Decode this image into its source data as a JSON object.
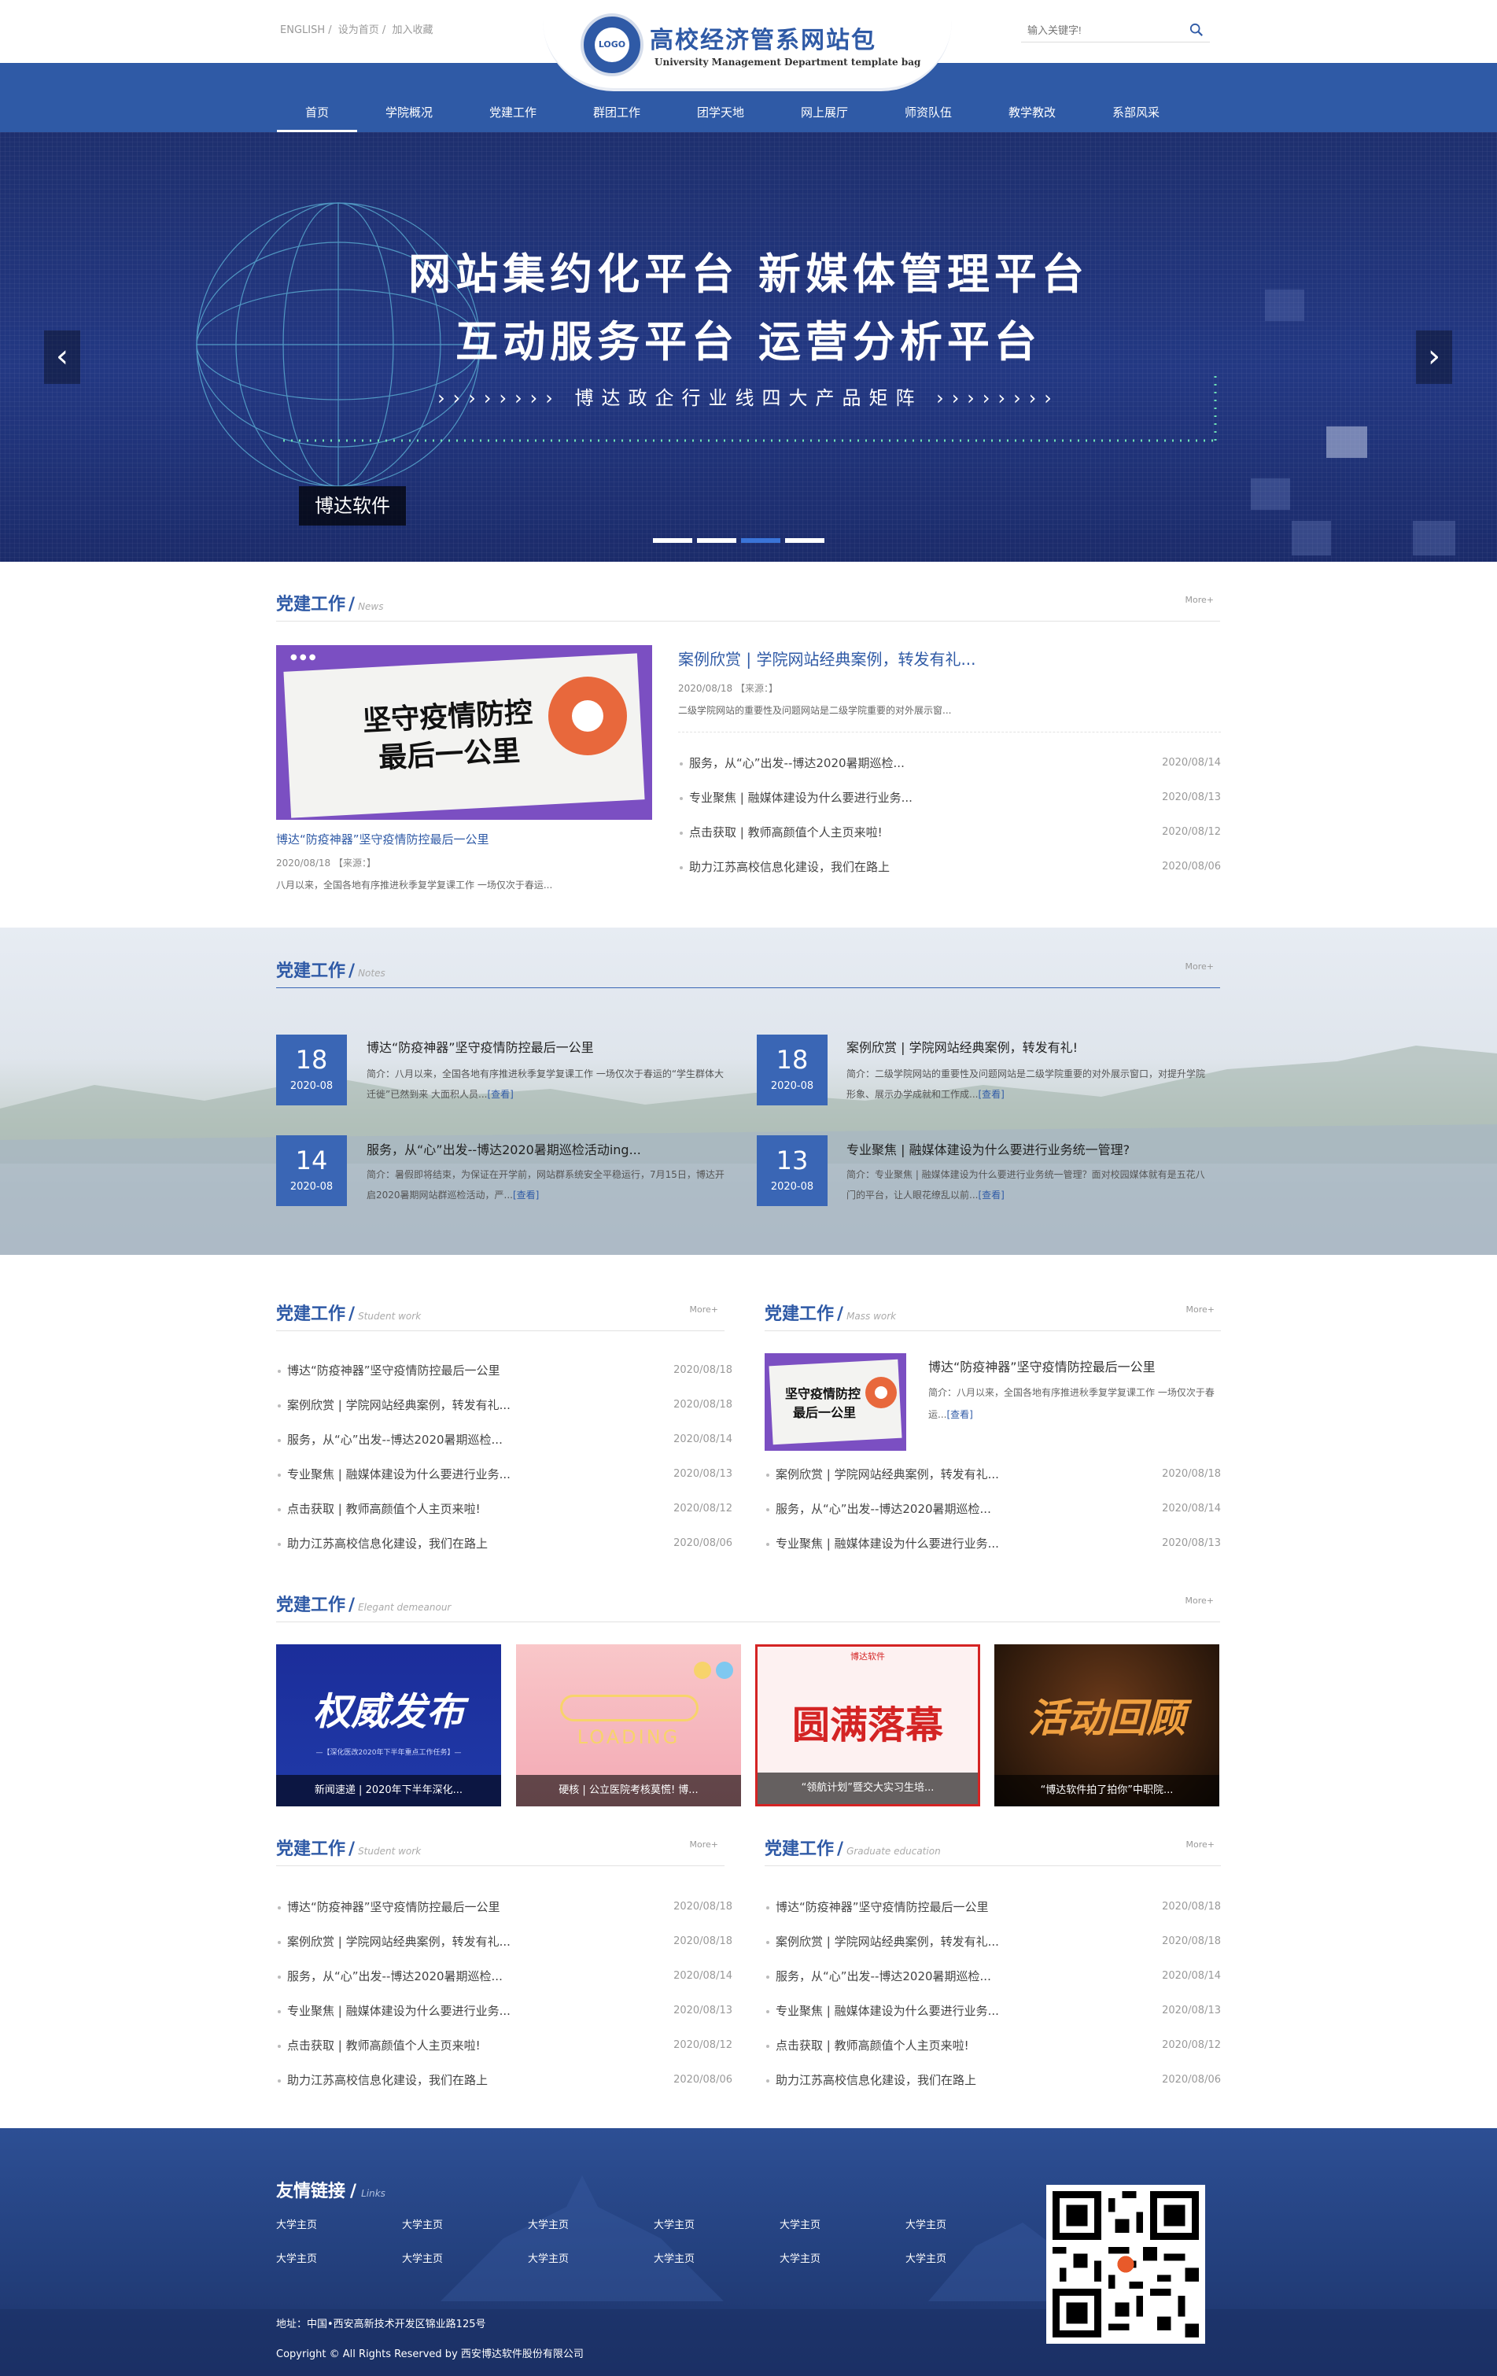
{
  "header": {
    "toplinks": [
      "ENGLISH /",
      "设为首页 /",
      "加入收藏"
    ],
    "logo_text": "LOGO",
    "site_title": "高校经济管系网站包",
    "site_subtitle": "University Management Department template bag",
    "search_placeholder": "输入关键字!",
    "nav": [
      "首页",
      "学院概况",
      "党建工作",
      "群团工作",
      "团学天地",
      "网上展厅",
      "师资队伍",
      "教学教改",
      "系部风采"
    ]
  },
  "banner": {
    "line1": "网站集约化平台  新媒体管理平台",
    "line2": "互动服务平台  运营分析平台",
    "line3": "››››››››  博达政企行业线四大产品矩阵  ››››››››",
    "caption": "博达软件",
    "prev": "‹",
    "next": "›"
  },
  "sec1": {
    "title": "党建工作",
    "en": "News",
    "more": "More+",
    "poster_line1": "坚守疫情防控",
    "poster_line2": "最后一公里",
    "feature_title": "博达“防疫神器”坚守疫情防控最后一公里",
    "feature_meta": "2020/08/18 【来源：】",
    "feature_summary": "八月以来，全国各地有序推进秋季复学复课工作 一场仅次于春运...",
    "head_title": "案例欣赏 | 学院网站经典案例，转发有礼...",
    "head_meta": "2020/08/18 【来源：】",
    "head_summary": "二级学院网站的重要性及问题网站是二级学院重要的对外展示窗...",
    "list": [
      {
        "t": "服务，从“心”出发--博达2020暑期巡检...",
        "d": "2020/08/14"
      },
      {
        "t": "专业聚焦 | 融媒体建设为什么要进行业务...",
        "d": "2020/08/13"
      },
      {
        "t": "点击获取 | 教师高颜值个人主页来啦!",
        "d": "2020/08/12"
      },
      {
        "t": "助力江苏高校信息化建设，我们在路上",
        "d": "2020/08/06"
      }
    ]
  },
  "sec2": {
    "title": "党建工作",
    "en": "Notes",
    "more": "More+",
    "items": [
      {
        "day": "18",
        "ym": "2020-08",
        "title": "博达“防疫神器”坚守疫情防控最后一公里",
        "sum": "简介：八月以来，全国各地有序推进秋季复学复课工作 一场仅次于春运的“学生群体大迁徙”已然到来 大面积人员...",
        "lk": "[查看]"
      },
      {
        "day": "18",
        "ym": "2020-08",
        "title": "案例欣赏 | 学院网站经典案例，转发有礼!",
        "sum": "简介：二级学院网站的重要性及问题网站是二级学院重要的对外展示窗口，对提升学院形象、展示办学成就和工作成...",
        "lk": "[查看]"
      },
      {
        "day": "14",
        "ym": "2020-08",
        "title": "服务，从“心”出发--博达2020暑期巡检活动ing...",
        "sum": "简介：暑假即将结束，为保证在开学前，网站群系统安全平稳运行，7月15日，博达开启2020暑期网站群巡检活动，严...",
        "lk": "[查看]"
      },
      {
        "day": "13",
        "ym": "2020-08",
        "title": "专业聚焦 | 融媒体建设为什么要进行业务统一管理?",
        "sum": "简介：专业聚焦 | 融媒体建设为什么要进行业务统一管理？面对校园媒体就有是五花八门的平台，让人眼花缭乱以前...",
        "lk": "[查看]"
      }
    ]
  },
  "sec3": {
    "left": {
      "title": "党建工作",
      "en": "Student work",
      "more": "More+",
      "list": [
        {
          "t": "博达“防疫神器”坚守疫情防控最后一公里",
          "d": "2020/08/18"
        },
        {
          "t": "案例欣赏 | 学院网站经典案例，转发有礼...",
          "d": "2020/08/18"
        },
        {
          "t": "服务，从“心”出发--博达2020暑期巡检...",
          "d": "2020/08/14"
        },
        {
          "t": "专业聚焦 | 融媒体建设为什么要进行业务...",
          "d": "2020/08/13"
        },
        {
          "t": "点击获取 | 教师高颜值个人主页来啦!",
          "d": "2020/08/12"
        },
        {
          "t": "助力江苏高校信息化建设，我们在路上",
          "d": "2020/08/06"
        }
      ]
    },
    "right": {
      "title": "党建工作",
      "en": "Mass work",
      "more": "More+",
      "feature_title": "博达“防疫神器”坚守疫情防控最后一公里",
      "feature_summary": "简介：八月以来，全国各地有序推进秋季复学复课工作 一场仅次于春运...",
      "feature_link": "[查看]",
      "list": [
        {
          "t": "案例欣赏 | 学院网站经典案例，转发有礼...",
          "d": "2020/08/18"
        },
        {
          "t": "服务，从“心”出发--博达2020暑期巡检...",
          "d": "2020/08/14"
        },
        {
          "t": "专业聚焦 | 融媒体建设为什么要进行业务...",
          "d": "2020/08/13"
        }
      ]
    }
  },
  "sec4": {
    "title": "党建工作",
    "en": "Elegant demeanour",
    "more": "More+",
    "items": [
      {
        "cap": "新闻速递 | 2020年下半年深化...",
        "art": "权威发布",
        "sub": "—【深化医改2020年下半年重点工作任务】—"
      },
      {
        "cap": "硬核 | 公立医院考核莫慌! 博...",
        "art": "LOADING",
        "sub": ""
      },
      {
        "cap": "“领航计划”暨交大实习生培...",
        "art": "圆满落幕",
        "sub": "博达软件"
      },
      {
        "cap": "“博达软件拍了拍你”中职院...",
        "art": "活动回顾",
        "sub": ""
      }
    ]
  },
  "sec5": {
    "left": {
      "title": "党建工作",
      "en": "Student work",
      "more": "More+",
      "list": [
        {
          "t": "博达“防疫神器”坚守疫情防控最后一公里",
          "d": "2020/08/18"
        },
        {
          "t": "案例欣赏 | 学院网站经典案例，转发有礼...",
          "d": "2020/08/18"
        },
        {
          "t": "服务，从“心”出发--博达2020暑期巡检...",
          "d": "2020/08/14"
        },
        {
          "t": "专业聚焦 | 融媒体建设为什么要进行业务...",
          "d": "2020/08/13"
        },
        {
          "t": "点击获取 | 教师高颜值个人主页来啦!",
          "d": "2020/08/12"
        },
        {
          "t": "助力江苏高校信息化建设，我们在路上",
          "d": "2020/08/06"
        }
      ]
    },
    "right": {
      "title": "党建工作",
      "en": "Graduate education",
      "more": "More+",
      "list": [
        {
          "t": "博达“防疫神器”坚守疫情防控最后一公里",
          "d": "2020/08/18"
        },
        {
          "t": "案例欣赏 | 学院网站经典案例，转发有礼...",
          "d": "2020/08/18"
        },
        {
          "t": "服务，从“心”出发--博达2020暑期巡检...",
          "d": "2020/08/14"
        },
        {
          "t": "专业聚焦 | 融媒体建设为什么要进行业务...",
          "d": "2020/08/13"
        },
        {
          "t": "点击获取 | 教师高颜值个人主页来啦!",
          "d": "2020/08/12"
        },
        {
          "t": "助力江苏高校信息化建设，我们在路上",
          "d": "2020/08/06"
        }
      ]
    }
  },
  "footer": {
    "title": "友情链接",
    "en": "Links",
    "links": [
      "大学主页",
      "大学主页",
      "大学主页",
      "大学主页",
      "大学主页",
      "大学主页",
      "大学主页",
      "大学主页",
      "大学主页",
      "大学主页",
      "大学主页",
      "大学主页"
    ],
    "address": "地址：中国•西安高新技术开发区锦业路125号",
    "copyright": "Copyright © All Rights Reserved by 西安博达软件股份有限公司"
  },
  "colors": {
    "primary": "#2f5aa6",
    "banner": "#233883",
    "footer": "#24417f"
  }
}
